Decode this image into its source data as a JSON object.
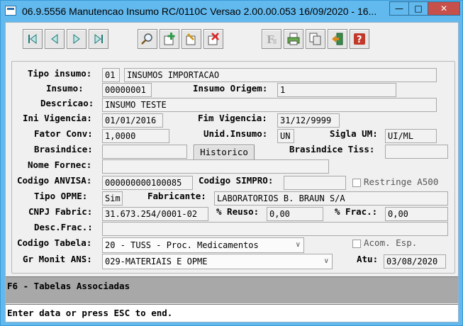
{
  "window": {
    "title": "06.9.5556 Manutencao  Insumo RC/0110C Versao 2.00.00.053 16/09/2020 - 16...",
    "minimize": "—",
    "maximize": "□",
    "close": "✕"
  },
  "toolbar": {
    "icons": [
      "first-record-icon",
      "previous-record-icon",
      "next-record-icon",
      "last-record-icon",
      "search-icon",
      "add-icon",
      "edit-icon",
      "delete-icon",
      "filter-icon",
      "print-icon",
      "copy-icon",
      "exit-icon",
      "help-icon"
    ]
  },
  "form": {
    "tipo_insumo": {
      "label": "Tipo insumo:",
      "code": "01",
      "desc": "INSUMOS IMPORTACAO"
    },
    "insumo": {
      "label": "Insumo:",
      "value": "00000001"
    },
    "insumo_origem": {
      "label": "Insumo Origem:",
      "value": "1"
    },
    "descricao": {
      "label": "Descricao:",
      "value": "INSUMO TESTE"
    },
    "ini_vigencia": {
      "label": "Ini Vigencia:",
      "value": "01/01/2016"
    },
    "fim_vigencia": {
      "label": "Fim Vigencia:",
      "value": "31/12/9999"
    },
    "fator_conv": {
      "label": "Fator Conv:",
      "value": "1,0000"
    },
    "unid_insumo": {
      "label": "Unid.Insumo:",
      "value": "UN"
    },
    "sigla_um": {
      "label": "Sigla UM:",
      "value": "UI/ML"
    },
    "brasindice": {
      "label": "Brasindice:",
      "value": ""
    },
    "historico_button": "Historico",
    "brasindice_tiss": {
      "label": "Brasindice Tiss:",
      "value": ""
    },
    "nome_fornec": {
      "label": "Nome Fornec:",
      "value": ""
    },
    "codigo_anvisa": {
      "label": "Codigo ANVISA:",
      "value": "000000000100085"
    },
    "codigo_simpro": {
      "label": "Codigo SIMPRO:",
      "value": ""
    },
    "restringe_a500": {
      "label": "Restringe A500",
      "checked": false
    },
    "tipo_opme": {
      "label": "Tipo OPME:",
      "value": "Sim"
    },
    "fabricante": {
      "label": "Fabricante:",
      "value": "LABORATORIOS B. BRAUN S/A"
    },
    "cnpj_fabric": {
      "label": "CNPJ Fabric:",
      "value": "31.673.254/0001-02"
    },
    "perc_reuso": {
      "label": "% Reuso:",
      "value": "0,00"
    },
    "perc_frac": {
      "label": "% Frac.:",
      "value": "0,00"
    },
    "desc_frac": {
      "label": "Desc.Frac.:",
      "value": ""
    },
    "codigo_tabela": {
      "label": "Codigo Tabela:",
      "value": "20 - TUSS - Proc. Medicamentos"
    },
    "acom_esp": {
      "label": "Acom. Esp.",
      "checked": false
    },
    "gr_monit_ans": {
      "label": "Gr Monit ANS:",
      "value": "029-MATERIAIS E OPME"
    },
    "atu": {
      "label": "Atu:",
      "value": "03/08/2020"
    }
  },
  "status": {
    "function_key_hint": "F6 - Tabelas Associadas",
    "message": "Enter data or press ESC to end."
  },
  "colors": {
    "titlebar": "#62b9ee",
    "close_button": "#c7504a",
    "panel_background": "#f0f0f0",
    "status_background": "#a8a8a8"
  }
}
